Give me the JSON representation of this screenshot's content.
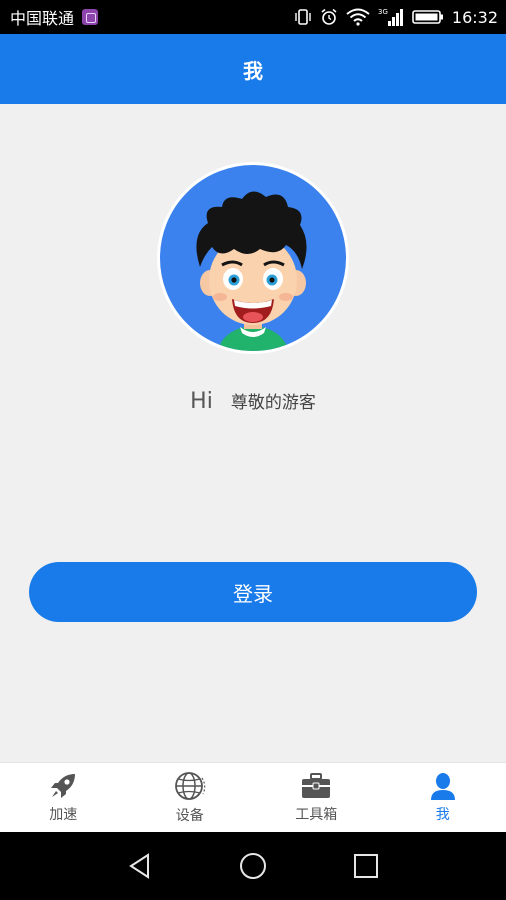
{
  "status_bar": {
    "carrier": "中国联通",
    "network_type": "3G",
    "time": "16:32"
  },
  "header": {
    "title": "我"
  },
  "profile": {
    "greeting": "Hi",
    "guest_name": "尊敬的游客"
  },
  "login": {
    "label": "登录"
  },
  "tabs": [
    {
      "label": "加速",
      "icon": "rocket-icon",
      "active": false
    },
    {
      "label": "设备",
      "icon": "globe-icon",
      "active": false
    },
    {
      "label": "工具箱",
      "icon": "toolbox-icon",
      "active": false
    },
    {
      "label": "我",
      "icon": "user-icon",
      "active": true
    }
  ],
  "colors": {
    "primary": "#197be9",
    "avatar_bg": "#3b82ee",
    "background": "#f0f0f0",
    "tab_inactive": "#555555"
  }
}
